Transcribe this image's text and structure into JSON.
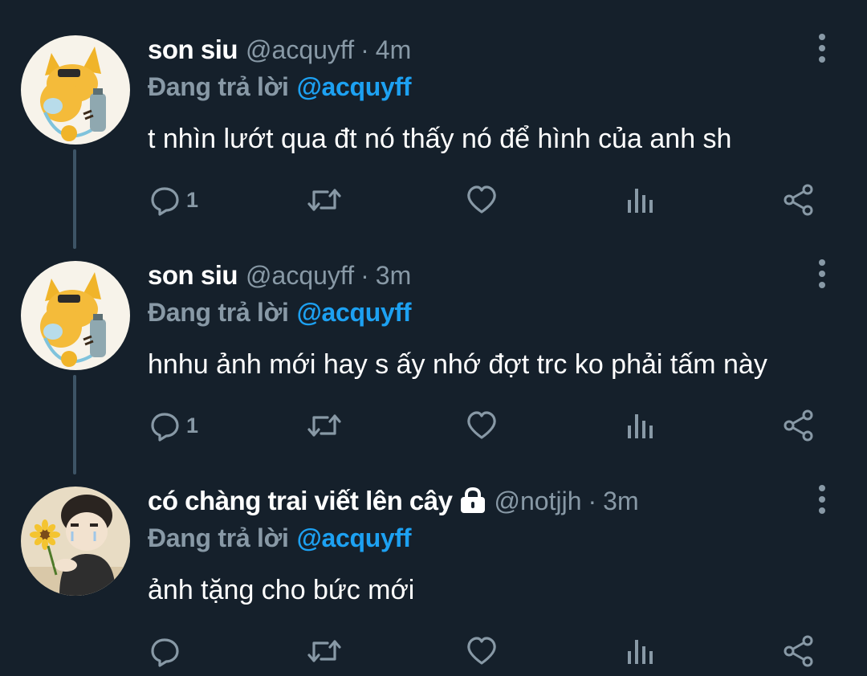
{
  "colors": {
    "background": "#15202b",
    "name": "#ffffff",
    "muted": "#8899a6",
    "link": "#1da1f2",
    "thread_line": "#3d5466"
  },
  "tweets": [
    {
      "name": "son siu",
      "handle": "@acquyff",
      "separator": "·",
      "time": "4m",
      "reply_prefix": "Đang trả lời",
      "reply_to": "@acquyff",
      "text": "t nhìn lướt qua đt nó thấy nó để hình của anh sh",
      "reply_count": "1",
      "locked": false,
      "avatar": "cat-avatar"
    },
    {
      "name": "son siu",
      "handle": "@acquyff",
      "separator": "·",
      "time": "3m",
      "reply_prefix": "Đang trả lời",
      "reply_to": "@acquyff",
      "text": "hnhu ảnh mới hay s ấy nhớ đợt trc ko phải tấm này",
      "reply_count": "1",
      "locked": false,
      "avatar": "cat-avatar"
    },
    {
      "name": "có chàng trai viết lên cây",
      "handle": "@notjjh",
      "separator": "·",
      "time": "3m",
      "reply_prefix": "Đang trả lời",
      "reply_to": "@acquyff",
      "text": "ảnh tặng cho bức mới",
      "reply_count": "",
      "locked": true,
      "avatar": "boy-sunflower-avatar"
    }
  ],
  "action_icons": [
    "reply-icon",
    "retweet-icon",
    "like-icon",
    "analytics-icon",
    "share-icon"
  ]
}
